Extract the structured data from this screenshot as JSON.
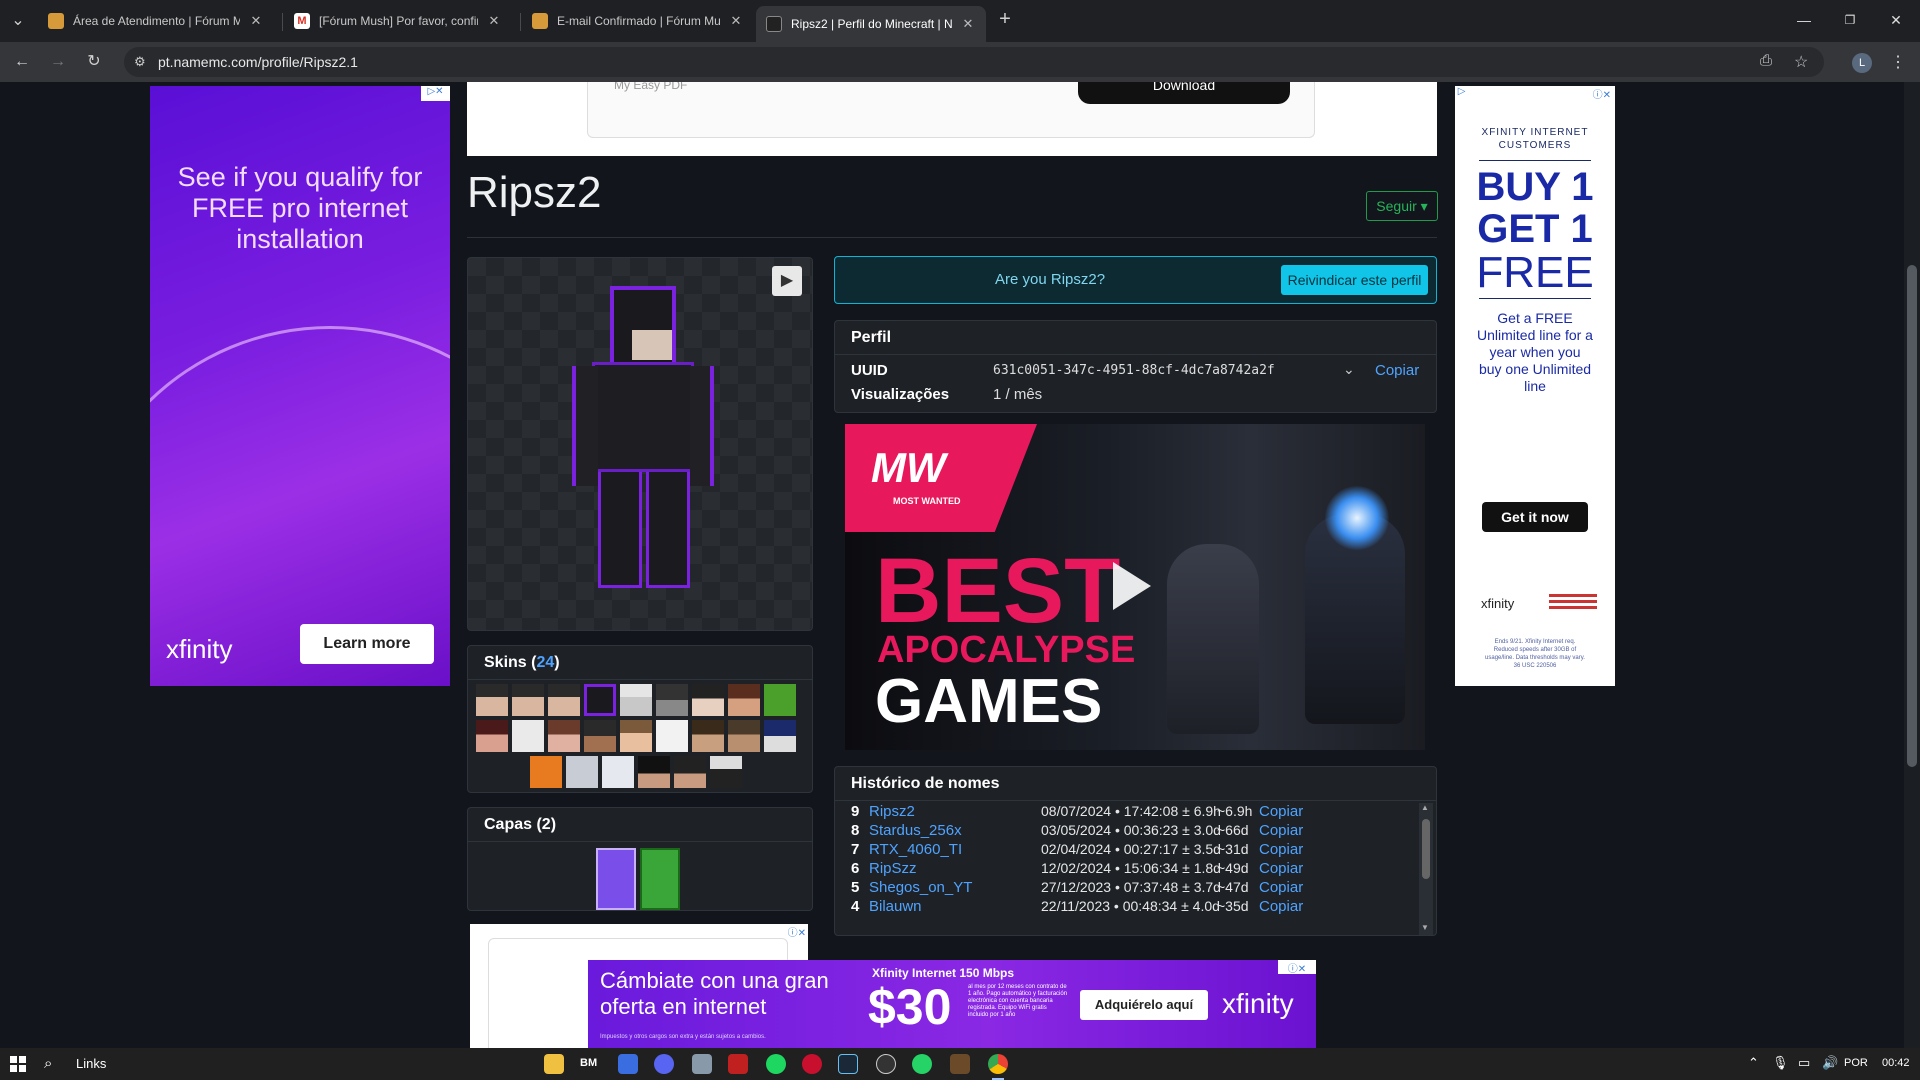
{
  "browser": {
    "tabs": [
      {
        "label": "Área de Atendimento | Fórum M",
        "active": false
      },
      {
        "label": "[Fórum Mush] Por favor, confir",
        "active": false
      },
      {
        "label": "E-mail Confirmado | Fórum Mu",
        "active": false
      },
      {
        "label": "Ripsz2 | Perfil do Minecraft | Na",
        "active": true
      }
    ],
    "url": "pt.namemc.com/profile/Ripsz2.1",
    "profile_initial": "L"
  },
  "ads": {
    "top_banner": {
      "brand": "My Easy PDF",
      "button": "Download"
    },
    "left": {
      "headline": "See if you qualify for FREE pro internet installation",
      "brand": "xfinity",
      "button": "Learn more"
    },
    "right": {
      "eyebrow": "XFINITY INTERNET CUSTOMERS",
      "headline1": "BUY 1",
      "headline2": "GET 1",
      "headline3": "FREE",
      "body": "Get a FREE Unlimited line for a year when you buy one Unlimited line",
      "button": "Get it now",
      "brand": "xfinity",
      "fine": "Ends 9/21. Xfinity Internet req. Reduced speeds after 30GB of usage/line. Data thresholds may vary. 36 USC 220506"
    },
    "video": {
      "logo_top": "MW",
      "logo_bottom": "MOST WANTED",
      "line1": "BEST",
      "line2": "APOCALYPSE",
      "line3": "GAMES"
    },
    "bottom": {
      "headline": "Cámbiate con una gran oferta en internet",
      "speed": "Xfinity Internet 150 Mbps",
      "price": "$30",
      "price_note": "al mes por 12 meses con contrato de 1 año. Pago automático y facturación electrónica con cuenta bancaria registrada. Equipo WiFi gratis incluido por 1 año",
      "fine": "Impuestos y otros cargos son extra y están sujetos a cambios.",
      "button": "Adquiérelo aquí",
      "brand": "xfinity"
    }
  },
  "profile": {
    "name": "Ripsz2",
    "follow_button": "Seguir",
    "claim_question": "Are you Ripsz2?",
    "claim_button": "Reivindicar este perfil",
    "panel_title": "Perfil",
    "uuid_label": "UUID",
    "uuid": "631c0051-347c-4951-88cf-4dc7a8742a2f",
    "copy_label": "Copiar",
    "views_label": "Visualizações",
    "views": "1 / mês"
  },
  "skins": {
    "title": "Skins",
    "count": "24"
  },
  "capes": {
    "title": "Capas (2)"
  },
  "name_history": {
    "title": "Histórico de nomes",
    "rows": [
      {
        "n": "9",
        "name": "Ripsz2",
        "date": "08/07/2024 • 17:42:08 ± 6.9h",
        "ago": "~6.9h",
        "copy": "Copiar"
      },
      {
        "n": "8",
        "name": "Stardus_256x",
        "date": "03/05/2024 • 00:36:23 ± 3.0d",
        "ago": "~66d",
        "copy": "Copiar"
      },
      {
        "n": "7",
        "name": "RTX_4060_TI",
        "date": "02/04/2024 • 00:27:17 ± 3.5d",
        "ago": "~31d",
        "copy": "Copiar"
      },
      {
        "n": "6",
        "name": "RipSzz",
        "date": "12/02/2024 • 15:06:34 ± 1.8d",
        "ago": "~49d",
        "copy": "Copiar"
      },
      {
        "n": "5",
        "name": "Shegos_on_YT",
        "date": "27/12/2023 • 07:37:48 ± 3.7d",
        "ago": "~47d",
        "copy": "Copiar"
      },
      {
        "n": "4",
        "name": "Bilauwn",
        "date": "22/11/2023 • 00:48:34 ± 4.0d",
        "ago": "~35d",
        "copy": "Copiar"
      }
    ]
  },
  "taskbar": {
    "search_label": "Links",
    "bm": "BM",
    "lang": "POR",
    "time": "00:42"
  }
}
